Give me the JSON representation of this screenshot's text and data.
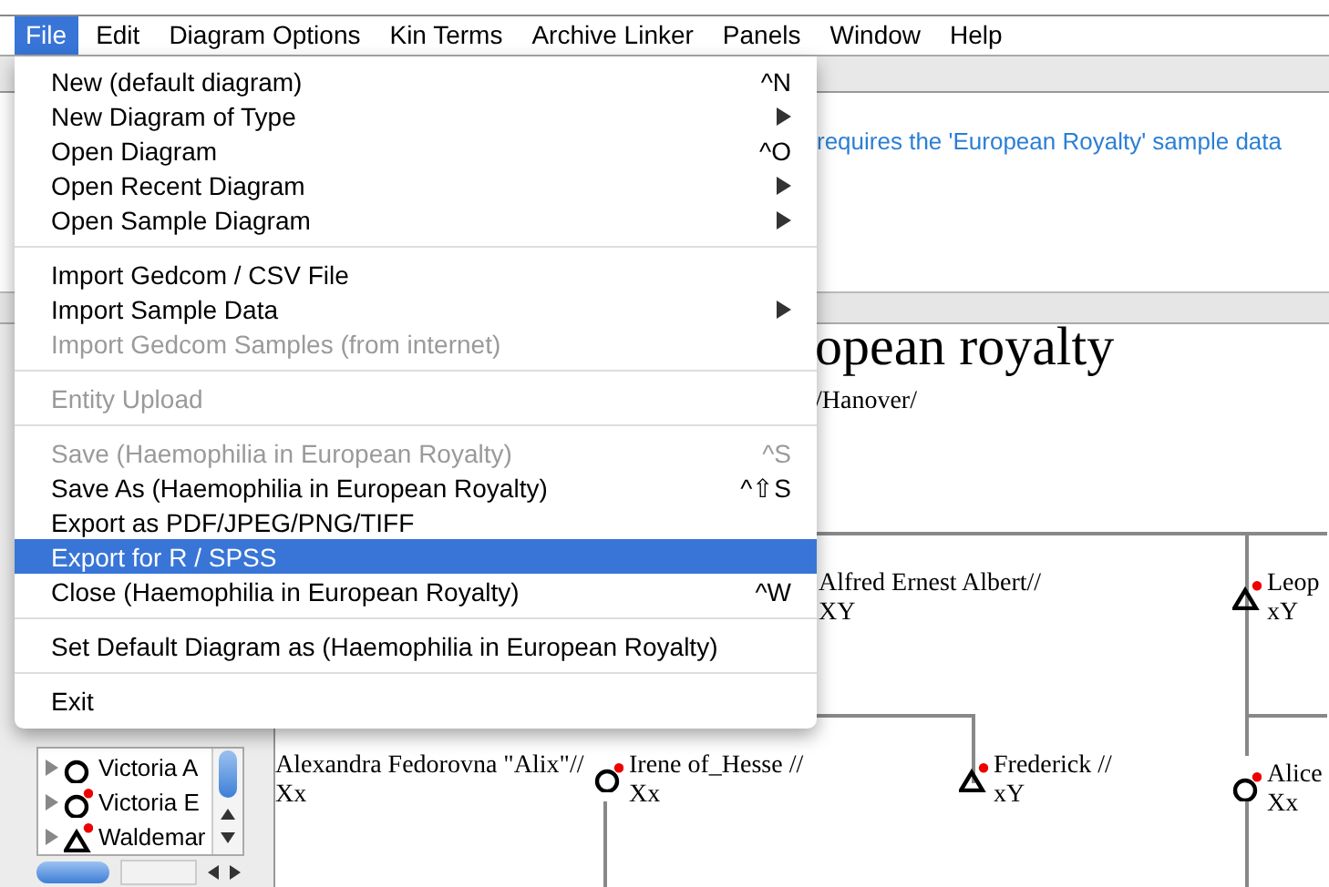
{
  "menubar": [
    {
      "label": "File",
      "selected": true
    },
    {
      "label": "Edit",
      "selected": false
    },
    {
      "label": "Diagram Options",
      "selected": false
    },
    {
      "label": "Kin Terms",
      "selected": false
    },
    {
      "label": "Archive Linker",
      "selected": false
    },
    {
      "label": "Panels",
      "selected": false
    },
    {
      "label": "Window",
      "selected": false
    },
    {
      "label": "Help",
      "selected": false
    }
  ],
  "message": "requires the 'European Royalty' sample data",
  "diagram": {
    "heading": "opean royalty",
    "nodes": [
      {
        "kind": "text",
        "name": "/Hanover/"
      },
      {
        "kind": "text",
        "name": "Alfred Ernest Albert//",
        "genotype": "XY"
      },
      {
        "kind": "triangle",
        "name": "Leop",
        "genotype": "xY",
        "marked": true
      },
      {
        "kind": "text",
        "name": "Alexandra Fedorovna \"Alix\"//",
        "genotype": "Xx"
      },
      {
        "kind": "circle",
        "name": "Irene of_Hesse //",
        "genotype": "Xx",
        "marked": true
      },
      {
        "kind": "triangle",
        "name": "Frederick //",
        "genotype": "xY",
        "marked": true
      },
      {
        "kind": "circle",
        "name": "Alice",
        "genotype": "Xx",
        "marked": true
      }
    ]
  },
  "tree": {
    "items": [
      {
        "kind": "circle",
        "label": "Victoria A",
        "marked": false
      },
      {
        "kind": "circle",
        "label": "Victoria E",
        "marked": true
      },
      {
        "kind": "triangle",
        "label": "Waldemar",
        "marked": true
      }
    ]
  },
  "file_menu": {
    "groups": [
      [
        {
          "label": "New (default diagram)",
          "shortcut": "^N",
          "submenu": false,
          "disabled": false,
          "selected": false
        },
        {
          "label": "New Diagram of Type",
          "submenu": true,
          "disabled": false,
          "selected": false
        },
        {
          "label": "Open Diagram",
          "shortcut": "^O",
          "submenu": false,
          "disabled": false,
          "selected": false
        },
        {
          "label": "Open Recent Diagram",
          "submenu": true,
          "disabled": false,
          "selected": false
        },
        {
          "label": "Open Sample Diagram",
          "submenu": true,
          "disabled": false,
          "selected": false
        }
      ],
      [
        {
          "label": "Import Gedcom / CSV File",
          "submenu": false,
          "disabled": false,
          "selected": false
        },
        {
          "label": "Import Sample Data",
          "submenu": true,
          "disabled": false,
          "selected": false
        },
        {
          "label": "Import Gedcom Samples (from internet)",
          "submenu": false,
          "disabled": true,
          "selected": false
        }
      ],
      [
        {
          "label": "Entity Upload",
          "submenu": false,
          "disabled": true,
          "selected": false
        }
      ],
      [
        {
          "label": "Save (Haemophilia in European Royalty)",
          "shortcut": "^S",
          "submenu": false,
          "disabled": true,
          "selected": false
        },
        {
          "label": "Save As (Haemophilia in European Royalty)",
          "shortcut": "^⇧S",
          "submenu": false,
          "disabled": false,
          "selected": false
        },
        {
          "label": "Export as PDF/JPEG/PNG/TIFF",
          "submenu": false,
          "disabled": false,
          "selected": false
        },
        {
          "label": "Export for R / SPSS",
          "submenu": false,
          "disabled": false,
          "selected": true
        },
        {
          "label": "Close (Haemophilia in European Royalty)",
          "shortcut": "^W",
          "submenu": false,
          "disabled": false,
          "selected": false
        }
      ],
      [
        {
          "label": "Set Default Diagram as (Haemophilia in European Royalty)",
          "submenu": false,
          "disabled": false,
          "selected": false
        }
      ],
      [
        {
          "label": "Exit",
          "submenu": false,
          "disabled": false,
          "selected": false
        }
      ]
    ]
  }
}
